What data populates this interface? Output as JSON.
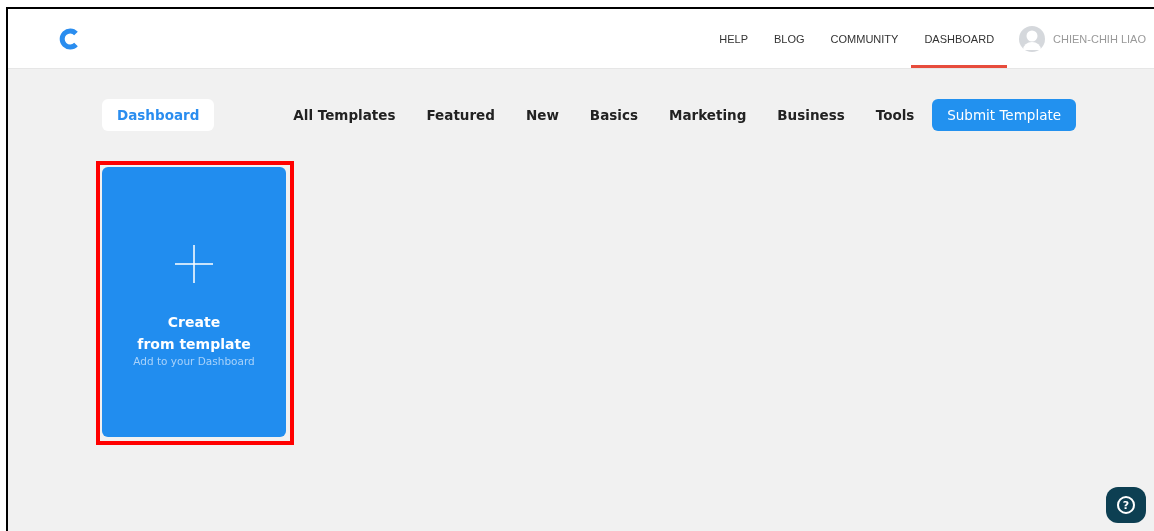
{
  "header": {
    "nav": [
      {
        "label": "HELP",
        "selected": false
      },
      {
        "label": "BLOG",
        "selected": false
      },
      {
        "label": "COMMUNITY",
        "selected": false
      },
      {
        "label": "DASHBOARD",
        "selected": true
      }
    ],
    "user": {
      "name": "CHIEN-CHIH LIAO"
    }
  },
  "tabs": [
    {
      "label": "Dashboard",
      "selected": true
    },
    {
      "label": "All Templates",
      "selected": false
    },
    {
      "label": "Featured",
      "selected": false
    },
    {
      "label": "New",
      "selected": false
    },
    {
      "label": "Basics",
      "selected": false
    },
    {
      "label": "Marketing",
      "selected": false
    },
    {
      "label": "Business",
      "selected": false
    },
    {
      "label": "Tools",
      "selected": false
    }
  ],
  "submit_button": "Submit Template",
  "create_card": {
    "title": "Create\nfrom template",
    "subtitle": "Add to your Dashboard",
    "highlighted": true
  },
  "help_button": {
    "glyph": "?"
  }
}
